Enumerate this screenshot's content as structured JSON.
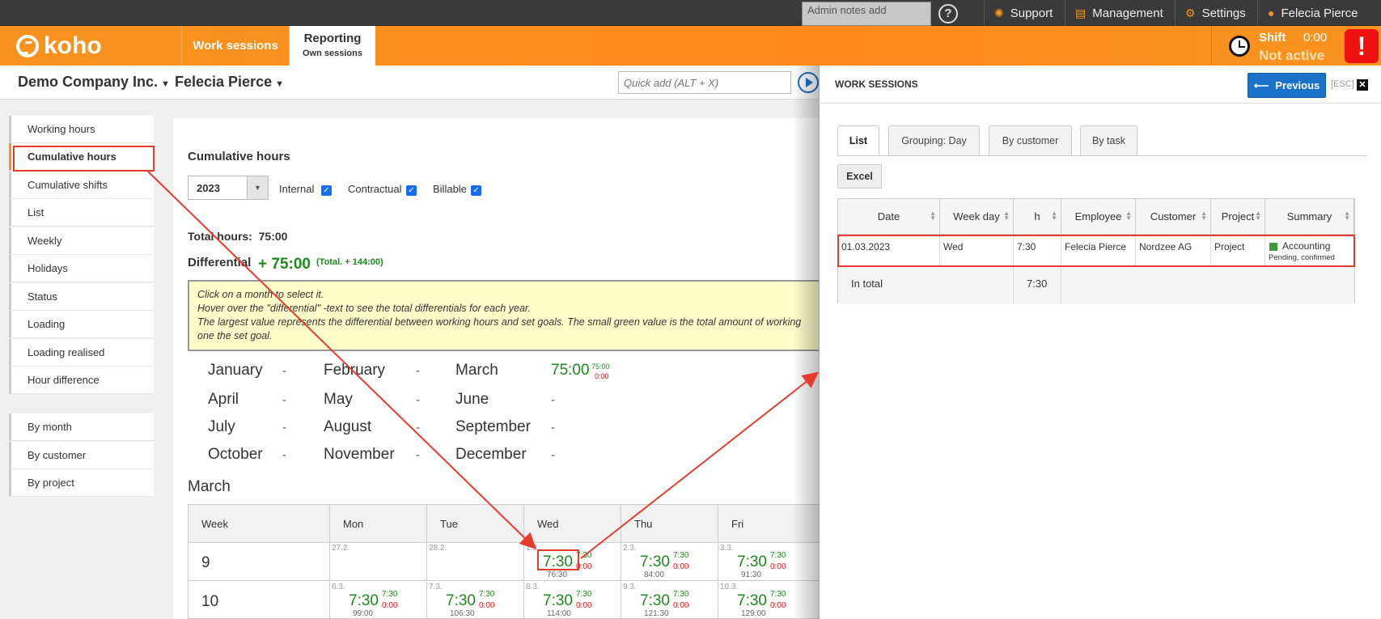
{
  "topbar": {
    "admin_notes_placeholder": "Admin notes add",
    "help_glyph": "?",
    "support": "Support",
    "management": "Management",
    "settings": "Settings",
    "user": "Felecia Pierce"
  },
  "header": {
    "logo_text": "koho",
    "tabs": [
      {
        "label": "Work sessions"
      },
      {
        "label": "Reporting",
        "sub": "Own sessions"
      }
    ],
    "shift_label": "Shift",
    "shift_time": "0:00",
    "shift_status": "Not active",
    "alert_glyph": "!"
  },
  "context": {
    "company": "Demo Company Inc.",
    "person": "Felecia Pierce",
    "quickadd_placeholder": "Quick add (ALT + X)"
  },
  "sidebar": {
    "items": [
      "Working hours",
      "Cumulative hours",
      "Cumulative shifts",
      "List",
      "Weekly",
      "Holidays",
      "Status",
      "Loading",
      "Loading realised",
      "Hour difference"
    ],
    "active_index": 1,
    "items2": [
      "By month",
      "By customer",
      "By project"
    ]
  },
  "main": {
    "title": "Cumulative hours",
    "year": "2023",
    "filters": [
      {
        "label": "Internal",
        "checked": true
      },
      {
        "label": "Contractual",
        "checked": true
      },
      {
        "label": "Billable",
        "checked": true
      }
    ],
    "total_label": "Total hours:",
    "total_value": "75:00",
    "diff_label": "Differential",
    "diff_value": "+ 75:00",
    "diff_total": "(Total. + 144:00)",
    "info": [
      "Click on a month to select it.",
      "Hover over the \"differential\" -text to see the total differentials for each year.",
      "The largest value represents the differential between working hours and set goals. The small green value is the total amount of working",
      "one the set goal."
    ],
    "months": [
      {
        "name": "January",
        "value": "-"
      },
      {
        "name": "February",
        "value": "-"
      },
      {
        "name": "March",
        "value": "75:00",
        "small_green": "75:00",
        "small_red": "0:00"
      },
      {
        "name": "April",
        "value": "-"
      },
      {
        "name": "May",
        "value": "-"
      },
      {
        "name": "June",
        "value": "-"
      },
      {
        "name": "July",
        "value": "-"
      },
      {
        "name": "August",
        "value": "-"
      },
      {
        "name": "September",
        "value": "-"
      },
      {
        "name": "October",
        "value": "-"
      },
      {
        "name": "November",
        "value": "-"
      },
      {
        "name": "December",
        "value": "-"
      }
    ],
    "selected_month": "March",
    "calendar": {
      "headers": [
        "Week",
        "Mon",
        "Tue",
        "Wed",
        "Thu",
        "Fri"
      ],
      "rows": [
        {
          "week": "9",
          "cells": [
            {
              "date": "27.2.",
              "value": "",
              "green": "",
              "red": "",
              "cum": ""
            },
            {
              "date": "28.2.",
              "value": "",
              "green": "",
              "red": "",
              "cum": ""
            },
            {
              "date": "1.3.",
              "value": "7:30",
              "green": "7:30",
              "red": "0:00",
              "cum": "76:30"
            },
            {
              "date": "2.3.",
              "value": "7:30",
              "green": "7:30",
              "red": "0:00",
              "cum": "84:00"
            },
            {
              "date": "3.3.",
              "value": "7:30",
              "green": "7:30",
              "red": "0:00",
              "cum": "91:30"
            }
          ]
        },
        {
          "week": "10",
          "cells": [
            {
              "date": "6.3.",
              "value": "7:30",
              "green": "7:30",
              "red": "0:00",
              "cum": "99:00"
            },
            {
              "date": "7.3.",
              "value": "7:30",
              "green": "7:30",
              "red": "0:00",
              "cum": "106:30"
            },
            {
              "date": "8.3.",
              "value": "7:30",
              "green": "7:30",
              "red": "0:00",
              "cum": "114:00"
            },
            {
              "date": "9.3.",
              "value": "7:30",
              "green": "7:30",
              "red": "0:00",
              "cum": "121:30"
            },
            {
              "date": "10.3.",
              "value": "7:30",
              "green": "7:30",
              "red": "0:00",
              "cum": "129:00"
            }
          ]
        }
      ]
    }
  },
  "panel": {
    "title": "WORK SESSIONS",
    "previous": "Previous",
    "esc": "[ESC]",
    "close_glyph": "✕",
    "tabs": [
      "List",
      "Grouping: Day",
      "By customer",
      "By task"
    ],
    "excel": "Excel",
    "columns": [
      "Date",
      "Week day",
      "h",
      "Employee",
      "Customer",
      "Project",
      "Summary"
    ],
    "row": {
      "date": "01.03.2023",
      "weekday": "Wed",
      "h": "7:30",
      "employee": "Felecia Pierce",
      "customer": "Nordzee AG",
      "project": "Project",
      "summary": "Accounting",
      "status": "Pending, confirmed"
    },
    "total_label": "In total",
    "total_h": "7:30"
  },
  "colors": {
    "brand": "#f7931e",
    "accent": "#1a73c8",
    "positive": "#1e8a1e",
    "negative": "#e11111",
    "highlight": "#e53c2e"
  }
}
